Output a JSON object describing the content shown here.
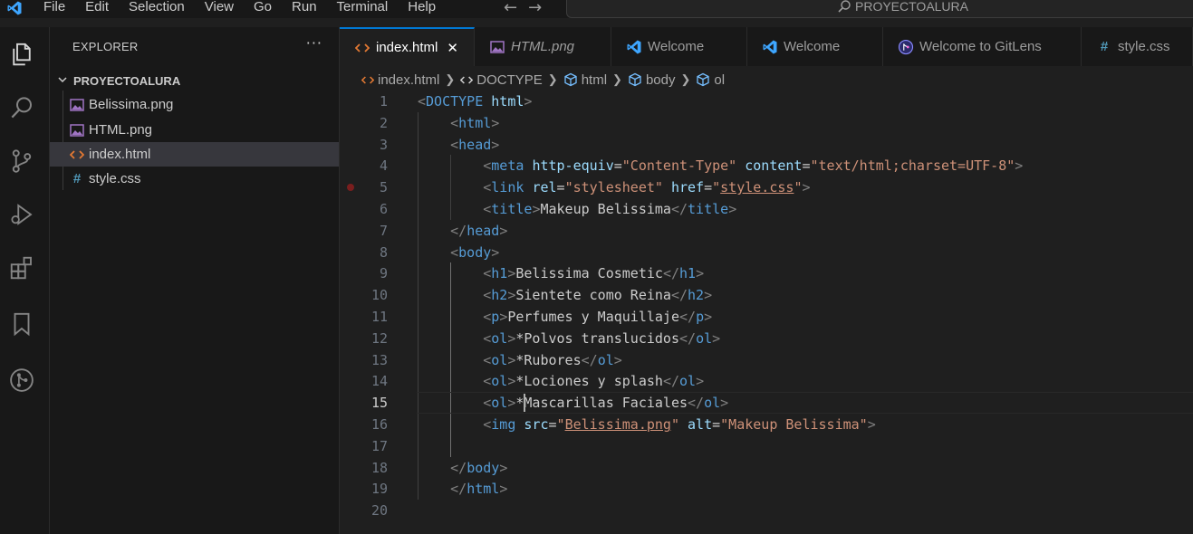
{
  "titlebar": {
    "menu": [
      "File",
      "Edit",
      "Selection",
      "View",
      "Go",
      "Run",
      "Terminal",
      "Help"
    ],
    "search_label": "PROYECTOALURA"
  },
  "activity": [
    "explorer-icon",
    "search-icon",
    "source-control-icon",
    "run-debug-icon",
    "extensions-icon",
    "bookmark-icon",
    "gitlens-icon"
  ],
  "sidebar": {
    "header": "EXPLORER",
    "more": "···",
    "folder": "PROYECTOALURA",
    "files": [
      {
        "name": "Belissima.png",
        "icon": "image-file-icon"
      },
      {
        "name": "HTML.png",
        "icon": "image-file-icon"
      },
      {
        "name": "index.html",
        "icon": "html-file-icon"
      },
      {
        "name": "style.css",
        "icon": "css-file-icon"
      }
    ],
    "active_index": 2
  },
  "tabs": [
    {
      "label": "index.html",
      "icon": "html-file-icon",
      "active": true,
      "italic": false
    },
    {
      "label": "HTML.png",
      "icon": "image-file-icon",
      "active": false,
      "italic": true
    },
    {
      "label": "Welcome",
      "icon": "vscode-icon",
      "active": false,
      "italic": false
    },
    {
      "label": "Welcome",
      "icon": "vscode-icon",
      "active": false,
      "italic": false
    },
    {
      "label": "Welcome to GitLens",
      "icon": "gitlens-icon",
      "active": false,
      "italic": false
    },
    {
      "label": "style.css",
      "icon": "css-file-icon",
      "active": false,
      "italic": false
    }
  ],
  "breadcrumb": [
    "index.html",
    "DOCTYPE",
    "html",
    "body",
    "ol"
  ],
  "editor": {
    "current_line": 15,
    "breakpoint_line": 5,
    "lines": [
      [
        [
          "<",
          "br"
        ],
        [
          "DOCTYPE",
          "kw"
        ],
        [
          " ",
          "txt"
        ],
        [
          "html",
          "b"
        ],
        [
          ">",
          "br"
        ]
      ],
      [
        [
          "    ",
          "txt"
        ],
        [
          "<",
          "br"
        ],
        [
          "html",
          "tag"
        ],
        [
          ">",
          "br"
        ]
      ],
      [
        [
          "    ",
          "txt"
        ],
        [
          "<",
          "br"
        ],
        [
          "head",
          "tag"
        ],
        [
          ">",
          "br"
        ]
      ],
      [
        [
          "        ",
          "txt"
        ],
        [
          "<",
          "br"
        ],
        [
          "meta",
          "tag"
        ],
        [
          " ",
          "txt"
        ],
        [
          "http-equiv",
          "at"
        ],
        [
          "=",
          "txt"
        ],
        [
          "\"Content-Type\"",
          "str"
        ],
        [
          " ",
          "txt"
        ],
        [
          "content",
          "at"
        ],
        [
          "=",
          "txt"
        ],
        [
          "\"text/html;charset=UTF-8\"",
          "str"
        ],
        [
          ">",
          "br"
        ]
      ],
      [
        [
          "        ",
          "txt"
        ],
        [
          "<",
          "br"
        ],
        [
          "link",
          "tag"
        ],
        [
          " ",
          "txt"
        ],
        [
          "rel",
          "at"
        ],
        [
          "=",
          "txt"
        ],
        [
          "\"stylesheet\"",
          "str"
        ],
        [
          " ",
          "txt"
        ],
        [
          "href",
          "at"
        ],
        [
          "=",
          "txt"
        ],
        [
          "\"",
          "str"
        ],
        [
          "style.css",
          "strlink"
        ],
        [
          "\"",
          "str"
        ],
        [
          ">",
          "br"
        ]
      ],
      [
        [
          "        ",
          "txt"
        ],
        [
          "<",
          "br"
        ],
        [
          "title",
          "tag"
        ],
        [
          ">",
          "br"
        ],
        [
          "Makeup Belissima",
          "txt"
        ],
        [
          "</",
          "br"
        ],
        [
          "title",
          "tag"
        ],
        [
          ">",
          "br"
        ]
      ],
      [
        [
          "    ",
          "txt"
        ],
        [
          "</",
          "br"
        ],
        [
          "head",
          "tag"
        ],
        [
          ">",
          "br"
        ]
      ],
      [
        [
          "    ",
          "txt"
        ],
        [
          "<",
          "br"
        ],
        [
          "body",
          "tag"
        ],
        [
          ">",
          "br"
        ]
      ],
      [
        [
          "        ",
          "txt"
        ],
        [
          "<",
          "br"
        ],
        [
          "h1",
          "tag"
        ],
        [
          ">",
          "br"
        ],
        [
          "Belissima Cosmetic",
          "txt"
        ],
        [
          "</",
          "br"
        ],
        [
          "h1",
          "tag"
        ],
        [
          ">",
          "br"
        ]
      ],
      [
        [
          "        ",
          "txt"
        ],
        [
          "<",
          "br"
        ],
        [
          "h2",
          "tag"
        ],
        [
          ">",
          "br"
        ],
        [
          "Sientete como Reina",
          "txt"
        ],
        [
          "</",
          "br"
        ],
        [
          "h2",
          "tag"
        ],
        [
          ">",
          "br"
        ]
      ],
      [
        [
          "        ",
          "txt"
        ],
        [
          "<",
          "br"
        ],
        [
          "p",
          "tag"
        ],
        [
          ">",
          "br"
        ],
        [
          "Perfumes y Maquillaje",
          "txt"
        ],
        [
          "</",
          "br"
        ],
        [
          "p",
          "tag"
        ],
        [
          ">",
          "br"
        ]
      ],
      [
        [
          "        ",
          "txt"
        ],
        [
          "<",
          "br"
        ],
        [
          "ol",
          "tag"
        ],
        [
          ">",
          "br"
        ],
        [
          "*Polvos translucidos",
          "txt"
        ],
        [
          "</",
          "br"
        ],
        [
          "ol",
          "tag"
        ],
        [
          ">",
          "br"
        ]
      ],
      [
        [
          "        ",
          "txt"
        ],
        [
          "<",
          "br"
        ],
        [
          "ol",
          "tag"
        ],
        [
          ">",
          "br"
        ],
        [
          "*Rubores",
          "txt"
        ],
        [
          "</",
          "br"
        ],
        [
          "ol",
          "tag"
        ],
        [
          ">",
          "br"
        ]
      ],
      [
        [
          "        ",
          "txt"
        ],
        [
          "<",
          "br"
        ],
        [
          "ol",
          "tag"
        ],
        [
          ">",
          "br"
        ],
        [
          "*Lociones y splash",
          "txt"
        ],
        [
          "</",
          "br"
        ],
        [
          "ol",
          "tag"
        ],
        [
          ">",
          "br"
        ]
      ],
      [
        [
          "        ",
          "txt"
        ],
        [
          "<",
          "br"
        ],
        [
          "ol",
          "tag"
        ],
        [
          ">",
          "br"
        ],
        [
          "*Mascarillas Faciales",
          "txt"
        ],
        [
          "</",
          "br"
        ],
        [
          "ol",
          "tag"
        ],
        [
          ">",
          "br"
        ]
      ],
      [
        [
          "        ",
          "txt"
        ],
        [
          "<",
          "br"
        ],
        [
          "img",
          "tag"
        ],
        [
          " ",
          "txt"
        ],
        [
          "src",
          "at"
        ],
        [
          "=",
          "txt"
        ],
        [
          "\"",
          "str"
        ],
        [
          "Belissima.png",
          "strlink"
        ],
        [
          "\"",
          "str"
        ],
        [
          " ",
          "txt"
        ],
        [
          "alt",
          "at"
        ],
        [
          "=",
          "txt"
        ],
        [
          "\"Makeup Belissima\"",
          "str"
        ],
        [
          ">",
          "br"
        ]
      ],
      [],
      [
        [
          "    ",
          "txt"
        ],
        [
          "</",
          "br"
        ],
        [
          "body",
          "tag"
        ],
        [
          ">",
          "br"
        ]
      ],
      [
        [
          "    ",
          "txt"
        ],
        [
          "</",
          "br"
        ],
        [
          "html",
          "tag"
        ],
        [
          ">",
          "br"
        ]
      ],
      []
    ]
  },
  "colors": {
    "accent": "#0078d4",
    "tag": "#569cd6",
    "attribute": "#9cdcfe",
    "string": "#ce9178",
    "html_icon": "#e37933",
    "css_icon": "#519aba",
    "image_icon": "#a074c4"
  }
}
